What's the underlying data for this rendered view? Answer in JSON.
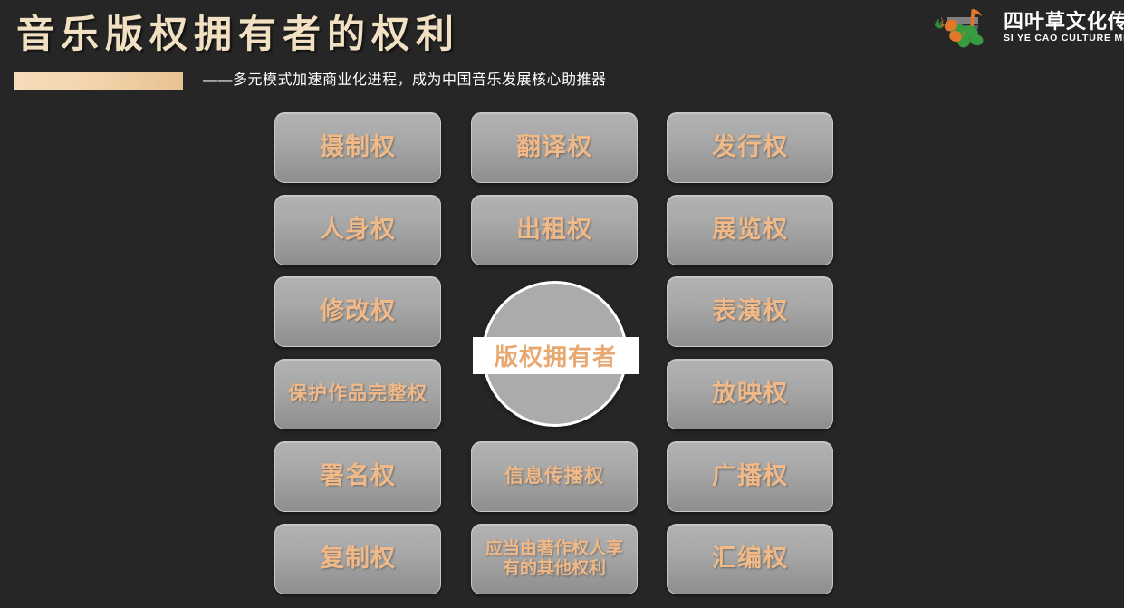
{
  "header": {
    "title": "音乐版权拥有者的权利",
    "subtitle": "——多元模式加速商业化进程，成为中国音乐发展核心助推器",
    "title_color": "#f2e0c2",
    "accent_bar_color": "#f3d5ad"
  },
  "logo": {
    "cn_name": "四叶草文化传媒",
    "en_name": "SI YE CAO CULTURE MEDIA",
    "mark_note_color": "#e2772a",
    "mark_clover_color": "#3a9a3f"
  },
  "center": {
    "label": "版权拥有者",
    "text_color": "#e8a871",
    "band_color": "#ffffff",
    "circle_color": "#ababab"
  },
  "theme": {
    "background": "#262626",
    "tile_text_color": "#f0b987",
    "tile_border_color": "#c8c8c8"
  },
  "grid": {
    "columns": [
      {
        "name": "left-column",
        "tiles": [
          {
            "label": "摄制权",
            "size": "normal"
          },
          {
            "label": "人身权",
            "size": "normal"
          },
          {
            "label": "修改权",
            "size": "normal"
          },
          {
            "label": "保护作品完整权",
            "size": "small"
          },
          {
            "label": "署名权",
            "size": "normal"
          },
          {
            "label": "复制权",
            "size": "normal"
          }
        ]
      },
      {
        "name": "center-column",
        "tiles": [
          {
            "label": "翻译权",
            "size": "normal"
          },
          {
            "label": "出租权",
            "size": "normal"
          },
          {
            "label": "信息传播权",
            "size": "small"
          },
          {
            "label": "应当由著作权人享有的其他权利",
            "size": "smaller"
          }
        ]
      },
      {
        "name": "right-column",
        "tiles": [
          {
            "label": "发行权",
            "size": "normal"
          },
          {
            "label": "展览权",
            "size": "normal"
          },
          {
            "label": "表演权",
            "size": "normal"
          },
          {
            "label": "放映权",
            "size": "normal"
          },
          {
            "label": "广播权",
            "size": "normal"
          },
          {
            "label": "汇编权",
            "size": "normal"
          }
        ]
      }
    ]
  }
}
